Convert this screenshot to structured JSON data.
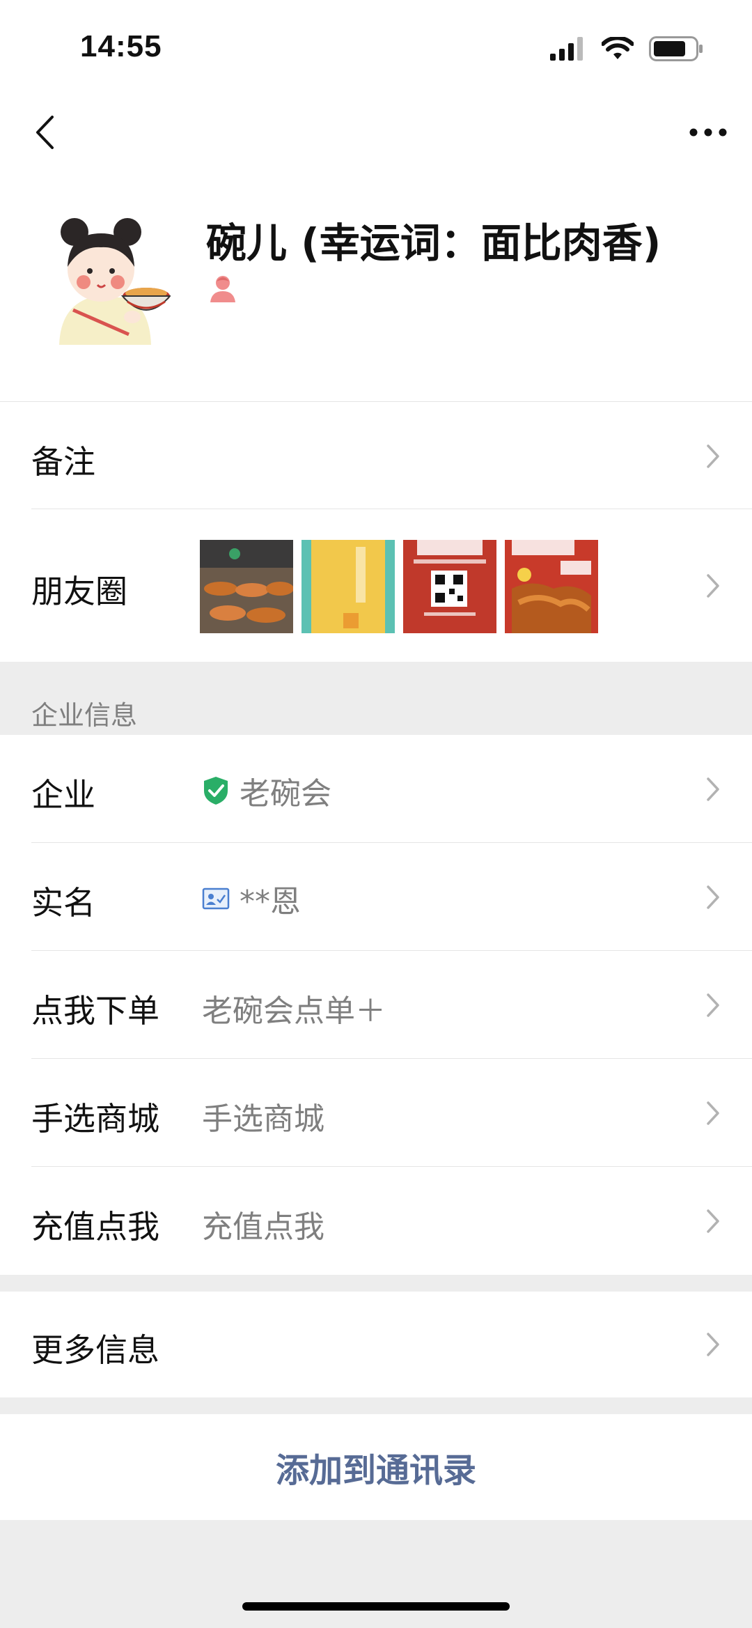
{
  "status_bar": {
    "time": "14:55",
    "icons": [
      "signal-icon",
      "wifi-icon",
      "battery-icon"
    ]
  },
  "nav": {
    "back_icon": "chevron-left-icon",
    "more_icon": "ellipsis-icon"
  },
  "profile": {
    "name": "碗儿 (幸运词：面比肉香)",
    "gender_icon": "female-icon",
    "avatar": "cartoon-avatar"
  },
  "rows": {
    "remark": {
      "label": "备注"
    },
    "moments": {
      "label": "朋友圈"
    },
    "enterprise_section_title": "企业信息",
    "enterprise": {
      "label": "企业",
      "value": "老碗会",
      "icon": "verified-shield-icon"
    },
    "real_name": {
      "label": "实名",
      "value": "**恩",
      "icon": "id-card-icon"
    },
    "order": {
      "label": "点我下单",
      "value": "老碗会点单＋"
    },
    "mall": {
      "label": "手选商城",
      "value": "手选商城"
    },
    "recharge": {
      "label": "充值点我",
      "value": "充值点我"
    },
    "more_info": {
      "label": "更多信息"
    }
  },
  "actions": {
    "add_to_contacts": "添加到通讯录"
  },
  "colors": {
    "accent_link": "#576b95",
    "verified_green": "#2aae67",
    "background": "#ededed",
    "card": "#ffffff"
  }
}
